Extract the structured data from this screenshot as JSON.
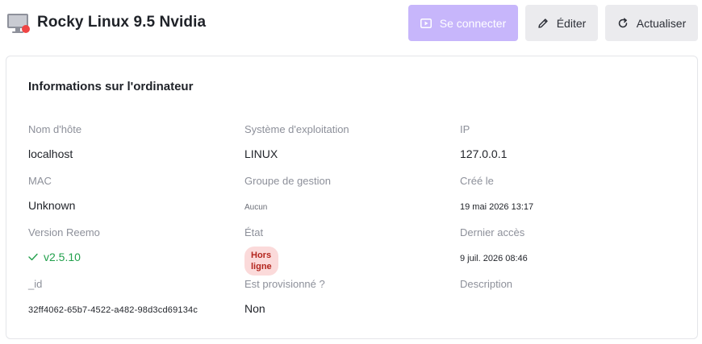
{
  "header": {
    "title": "Rocky Linux 9.5 Nvidia",
    "buttons": {
      "connect": "Se connecter",
      "edit": "Éditer",
      "refresh": "Actualiser"
    }
  },
  "colors": {
    "connect_bg": "#c7b6fb",
    "status_offline": "#ef4444",
    "version_ok": "#22a04c",
    "badge_bg": "#fbdada",
    "badge_text": "#b3261e"
  },
  "card": {
    "title": "Informations sur l'ordinateur",
    "fields": {
      "hostname": {
        "label": "Nom d'hôte",
        "value": "localhost"
      },
      "os": {
        "label": "Système d'exploitation",
        "value": "LINUX"
      },
      "ip": {
        "label": "IP",
        "value": "127.0.0.1"
      },
      "mac": {
        "label": "MAC",
        "value": "Unknown"
      },
      "group": {
        "label": "Groupe de gestion",
        "value": "Aucun"
      },
      "created": {
        "label": "Créé le",
        "value": "19 mai 2026 13:17"
      },
      "version": {
        "label": "Version Reemo",
        "value": "v2.5.10"
      },
      "state": {
        "label": "État",
        "value": "Hors ligne"
      },
      "last_access": {
        "label": "Dernier accès",
        "value": "9 juil. 2026 08:46"
      },
      "id": {
        "label": "_id",
        "value": "32ff4062-65b7-4522-a482-98d3cd69134c"
      },
      "provisioned": {
        "label": "Est provisionné ?",
        "value": "Non"
      },
      "description": {
        "label": "Description",
        "value": ""
      }
    }
  }
}
